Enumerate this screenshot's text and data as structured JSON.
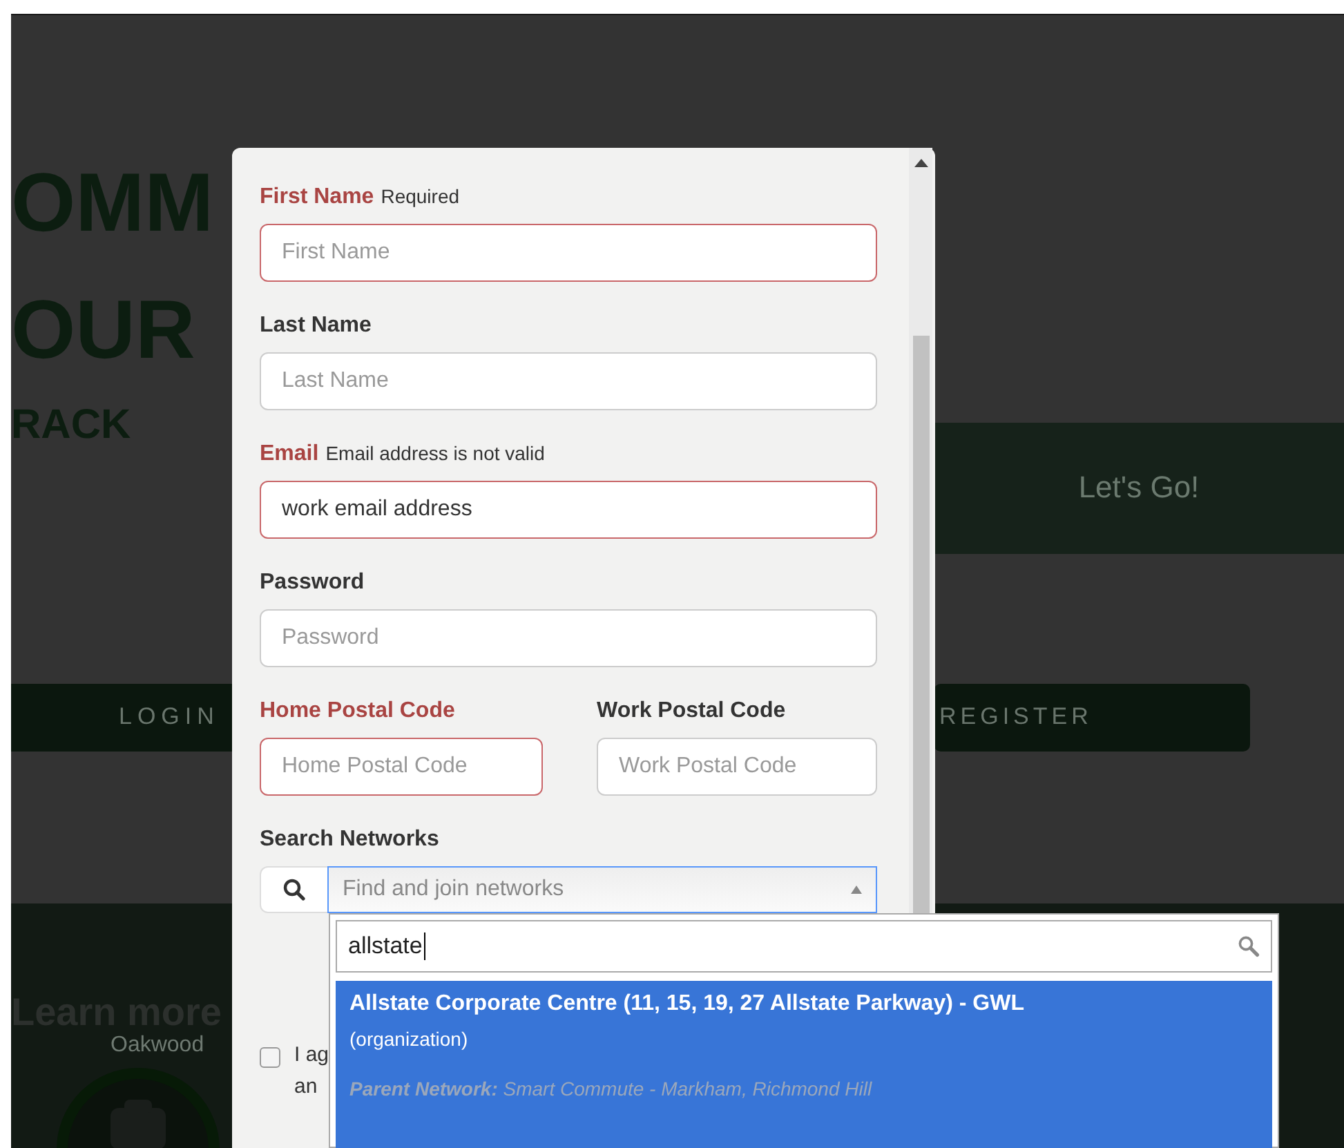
{
  "background": {
    "headline_lines": [
      "OMM",
      "OUR"
    ],
    "subheading": "RACK",
    "cta_button": "Let's Go!",
    "login_button": "LOGIN",
    "register_button": "REGISTER",
    "learn_more": "Learn more",
    "location": "Oakwood"
  },
  "form": {
    "fields": [
      {
        "label": "First Name",
        "error": true,
        "message": "Required",
        "placeholder": "First Name"
      },
      {
        "label": "Last Name",
        "error": false,
        "placeholder": "Last Name"
      },
      {
        "label": "Email",
        "error": true,
        "message": "Email address is not valid",
        "value": "work email address"
      },
      {
        "label": "Password",
        "error": false,
        "placeholder": "Password"
      }
    ],
    "postal_codes": [
      {
        "label": "Home Postal Code",
        "error": true,
        "placeholder": "Home Postal Code"
      },
      {
        "label": "Work Postal Code",
        "error": false,
        "placeholder": "Work Postal Code"
      }
    ],
    "network_search": {
      "label": "Search Networks",
      "placeholder": "Find and join networks",
      "open": true,
      "query": "allstate",
      "results": [
        {
          "name": "Allstate Corporate Centre (11, 15, 19, 27 Allstate Parkway) - GWL",
          "type": "(organization)",
          "parent_label": "Parent Network:",
          "parent": "Smart Commute - Markham, Richmond Hill",
          "selected": true
        }
      ]
    },
    "terms": {
      "checked": false,
      "lines": [
        "I ag",
        "an"
      ]
    }
  }
}
